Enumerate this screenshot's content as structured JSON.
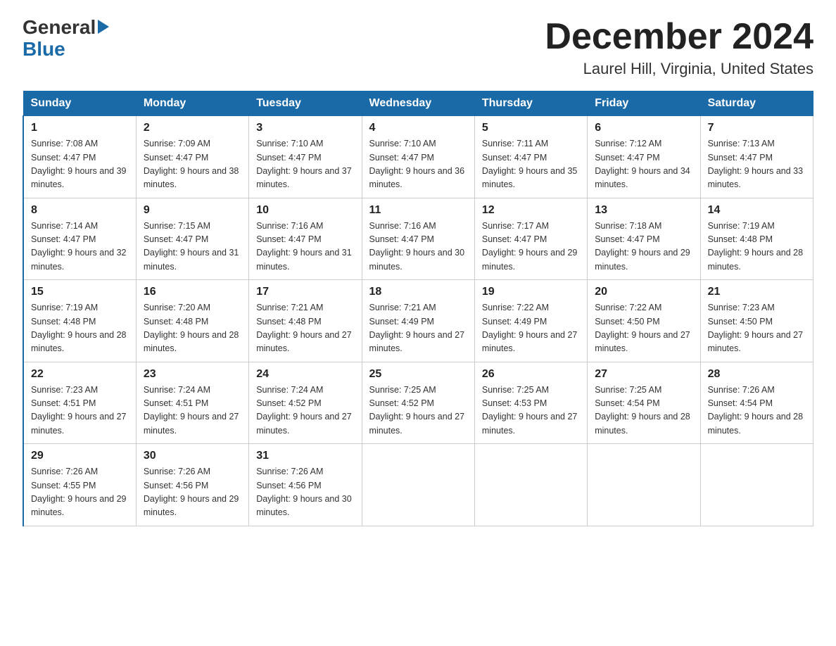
{
  "logo": {
    "general": "General",
    "blue": "Blue"
  },
  "header": {
    "month": "December 2024",
    "location": "Laurel Hill, Virginia, United States"
  },
  "days_of_week": [
    "Sunday",
    "Monday",
    "Tuesday",
    "Wednesday",
    "Thursday",
    "Friday",
    "Saturday"
  ],
  "weeks": [
    [
      {
        "day": "1",
        "sunrise": "7:08 AM",
        "sunset": "4:47 PM",
        "daylight": "9 hours and 39 minutes."
      },
      {
        "day": "2",
        "sunrise": "7:09 AM",
        "sunset": "4:47 PM",
        "daylight": "9 hours and 38 minutes."
      },
      {
        "day": "3",
        "sunrise": "7:10 AM",
        "sunset": "4:47 PM",
        "daylight": "9 hours and 37 minutes."
      },
      {
        "day": "4",
        "sunrise": "7:10 AM",
        "sunset": "4:47 PM",
        "daylight": "9 hours and 36 minutes."
      },
      {
        "day": "5",
        "sunrise": "7:11 AM",
        "sunset": "4:47 PM",
        "daylight": "9 hours and 35 minutes."
      },
      {
        "day": "6",
        "sunrise": "7:12 AM",
        "sunset": "4:47 PM",
        "daylight": "9 hours and 34 minutes."
      },
      {
        "day": "7",
        "sunrise": "7:13 AM",
        "sunset": "4:47 PM",
        "daylight": "9 hours and 33 minutes."
      }
    ],
    [
      {
        "day": "8",
        "sunrise": "7:14 AM",
        "sunset": "4:47 PM",
        "daylight": "9 hours and 32 minutes."
      },
      {
        "day": "9",
        "sunrise": "7:15 AM",
        "sunset": "4:47 PM",
        "daylight": "9 hours and 31 minutes."
      },
      {
        "day": "10",
        "sunrise": "7:16 AM",
        "sunset": "4:47 PM",
        "daylight": "9 hours and 31 minutes."
      },
      {
        "day": "11",
        "sunrise": "7:16 AM",
        "sunset": "4:47 PM",
        "daylight": "9 hours and 30 minutes."
      },
      {
        "day": "12",
        "sunrise": "7:17 AM",
        "sunset": "4:47 PM",
        "daylight": "9 hours and 29 minutes."
      },
      {
        "day": "13",
        "sunrise": "7:18 AM",
        "sunset": "4:47 PM",
        "daylight": "9 hours and 29 minutes."
      },
      {
        "day": "14",
        "sunrise": "7:19 AM",
        "sunset": "4:48 PM",
        "daylight": "9 hours and 28 minutes."
      }
    ],
    [
      {
        "day": "15",
        "sunrise": "7:19 AM",
        "sunset": "4:48 PM",
        "daylight": "9 hours and 28 minutes."
      },
      {
        "day": "16",
        "sunrise": "7:20 AM",
        "sunset": "4:48 PM",
        "daylight": "9 hours and 28 minutes."
      },
      {
        "day": "17",
        "sunrise": "7:21 AM",
        "sunset": "4:48 PM",
        "daylight": "9 hours and 27 minutes."
      },
      {
        "day": "18",
        "sunrise": "7:21 AM",
        "sunset": "4:49 PM",
        "daylight": "9 hours and 27 minutes."
      },
      {
        "day": "19",
        "sunrise": "7:22 AM",
        "sunset": "4:49 PM",
        "daylight": "9 hours and 27 minutes."
      },
      {
        "day": "20",
        "sunrise": "7:22 AM",
        "sunset": "4:50 PM",
        "daylight": "9 hours and 27 minutes."
      },
      {
        "day": "21",
        "sunrise": "7:23 AM",
        "sunset": "4:50 PM",
        "daylight": "9 hours and 27 minutes."
      }
    ],
    [
      {
        "day": "22",
        "sunrise": "7:23 AM",
        "sunset": "4:51 PM",
        "daylight": "9 hours and 27 minutes."
      },
      {
        "day": "23",
        "sunrise": "7:24 AM",
        "sunset": "4:51 PM",
        "daylight": "9 hours and 27 minutes."
      },
      {
        "day": "24",
        "sunrise": "7:24 AM",
        "sunset": "4:52 PM",
        "daylight": "9 hours and 27 minutes."
      },
      {
        "day": "25",
        "sunrise": "7:25 AM",
        "sunset": "4:52 PM",
        "daylight": "9 hours and 27 minutes."
      },
      {
        "day": "26",
        "sunrise": "7:25 AM",
        "sunset": "4:53 PM",
        "daylight": "9 hours and 27 minutes."
      },
      {
        "day": "27",
        "sunrise": "7:25 AM",
        "sunset": "4:54 PM",
        "daylight": "9 hours and 28 minutes."
      },
      {
        "day": "28",
        "sunrise": "7:26 AM",
        "sunset": "4:54 PM",
        "daylight": "9 hours and 28 minutes."
      }
    ],
    [
      {
        "day": "29",
        "sunrise": "7:26 AM",
        "sunset": "4:55 PM",
        "daylight": "9 hours and 29 minutes."
      },
      {
        "day": "30",
        "sunrise": "7:26 AM",
        "sunset": "4:56 PM",
        "daylight": "9 hours and 29 minutes."
      },
      {
        "day": "31",
        "sunrise": "7:26 AM",
        "sunset": "4:56 PM",
        "daylight": "9 hours and 30 minutes."
      },
      null,
      null,
      null,
      null
    ]
  ]
}
